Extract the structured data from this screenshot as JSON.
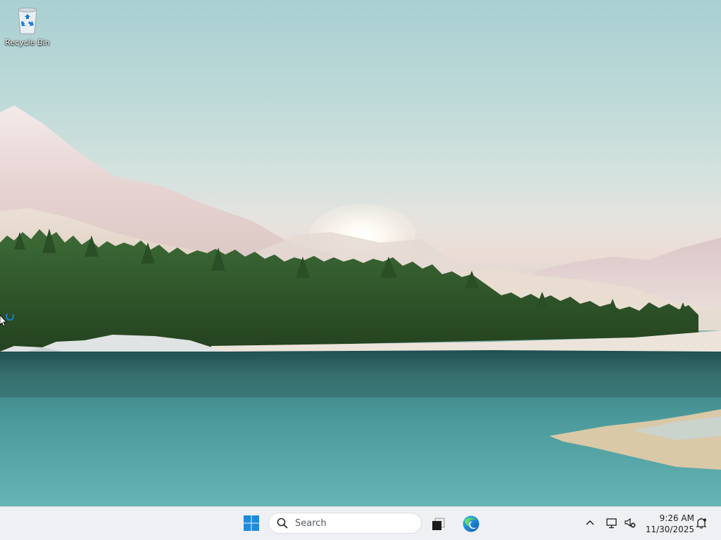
{
  "desktop": {
    "icons": [
      {
        "label": "Recycle Bin",
        "icon": "recycle-bin-icon"
      }
    ],
    "wallpaper": "lake-forest-mountains-sunrise"
  },
  "taskbar": {
    "start_icon": "windows-start-icon",
    "search": {
      "placeholder": "Search",
      "icon": "search-icon"
    },
    "pinned": [
      {
        "name": "task-view",
        "icon": "task-view-icon"
      },
      {
        "name": "microsoft-edge",
        "icon": "edge-icon"
      }
    ],
    "tray": {
      "chevron_icon": "chevron-up-icon",
      "network_icon": "network-icon",
      "volume_icon": "volume-muted-icon",
      "time": "9:26 AM",
      "date": "11/30/2025",
      "notification_icon": "notification-bell-icon"
    }
  },
  "colors": {
    "taskbar_bg": "#eef0f3",
    "windows_blue": "#0078d4",
    "sky": "#a9cfd2",
    "water": "#4e9a9c",
    "forest": "#2f5a2c"
  }
}
